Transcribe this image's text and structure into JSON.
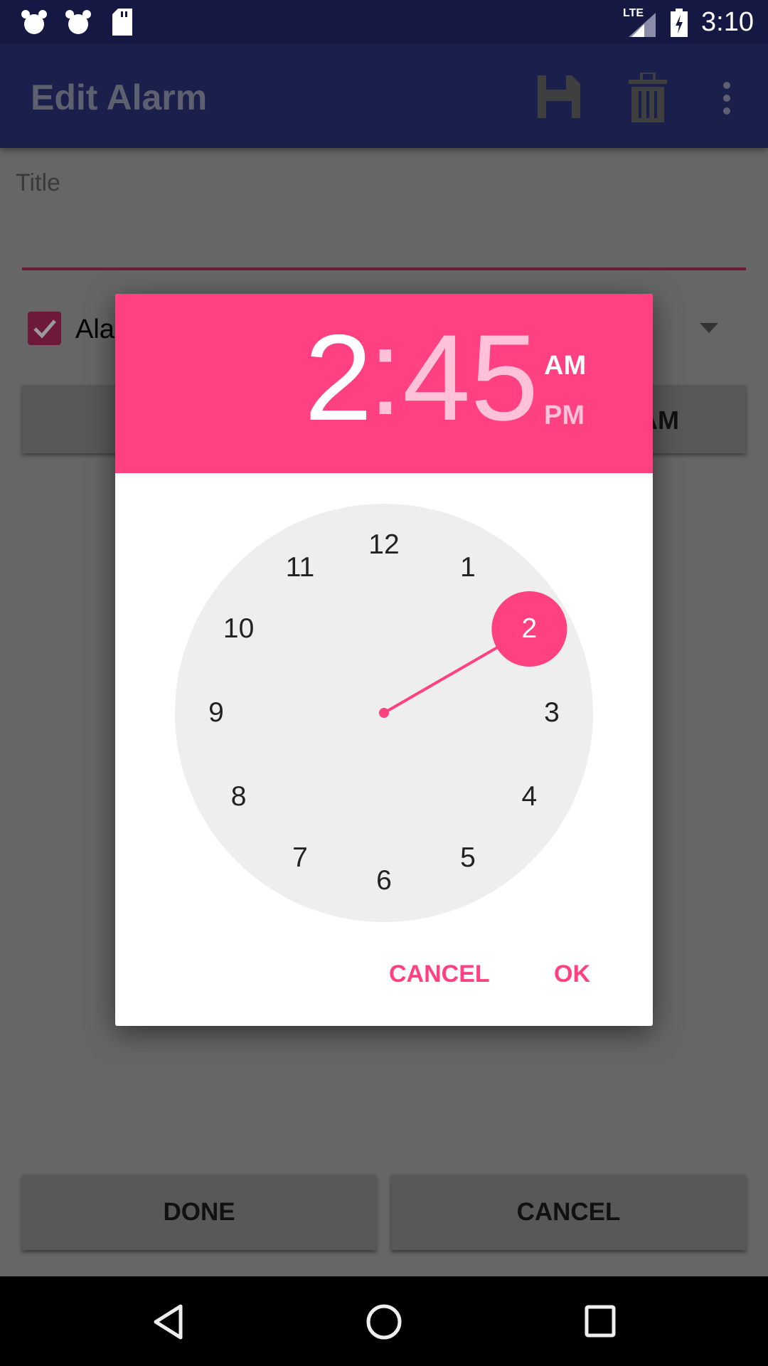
{
  "status_bar": {
    "time": "3:10",
    "network": "LTE",
    "icons": [
      "alarm-icon",
      "alarm-icon",
      "sd-card-icon",
      "signal-icon",
      "battery-charging-icon"
    ]
  },
  "app_bar": {
    "title": "Edit Alarm",
    "actions": [
      "save-icon",
      "delete-icon",
      "more-vert-icon"
    ]
  },
  "form": {
    "title_label": "Title",
    "title_value": "",
    "alarm_checkbox_label": "Alar",
    "alarm_checked": true,
    "partial_button_label": "AM"
  },
  "bottom_buttons": {
    "done": "DONE",
    "cancel": "CANCEL"
  },
  "dialog": {
    "hour": "2",
    "separator": ":",
    "minute": "45",
    "am": "AM",
    "pm": "PM",
    "selected_period": "AM",
    "clock_numbers": [
      "12",
      "1",
      "2",
      "3",
      "4",
      "5",
      "6",
      "7",
      "8",
      "9",
      "10",
      "11"
    ],
    "selected_hour": 2,
    "cancel": "CANCEL",
    "ok": "OK"
  },
  "colors": {
    "accent": "#ff4081",
    "app_bar": "#1a1f4b",
    "status_bar": "#151843",
    "minute_inactive": "#ffc1d7",
    "clock_face": "#eeeeee"
  }
}
